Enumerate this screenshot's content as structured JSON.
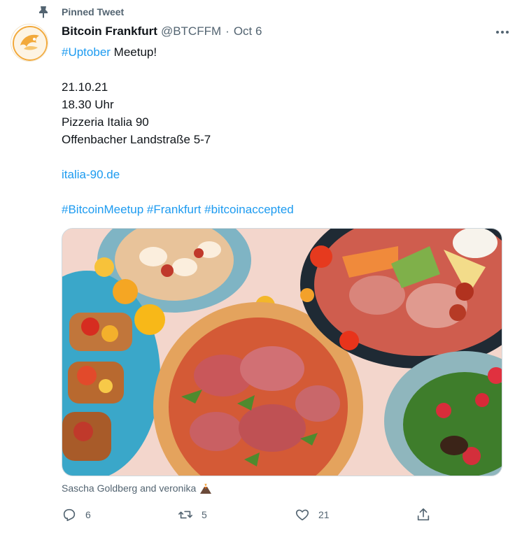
{
  "pinned": {
    "label": "Pinned Tweet",
    "icon": "pin-icon"
  },
  "author": {
    "name": "Bitcoin Frankfurt",
    "handle": "@BTCFFM",
    "separator": "·",
    "date": "Oct 6"
  },
  "tweet": {
    "hashtag_uptober": "#Uptober",
    "title_rest": " Meetup!",
    "date_line": "21.10.21",
    "time_line": "18.30 Uhr",
    "venue_line": "Pizzeria Italia 90",
    "address_line": "Offenbacher Landstraße 5-7",
    "website": "italia-90.de",
    "hashtags": [
      "#BitcoinMeetup",
      "#Frankfurt",
      "#bitcoinaccepted"
    ]
  },
  "tagged": {
    "text": "Sascha Goldberg and veronika",
    "emoji_icon": "volcano-icon"
  },
  "actions": {
    "reply_count": "6",
    "retweet_count": "5",
    "like_count": "21"
  },
  "colors": {
    "link": "#1d9bf0",
    "secondary_text": "#536471",
    "primary_text": "#0f1419",
    "border": "#cfd9de"
  }
}
